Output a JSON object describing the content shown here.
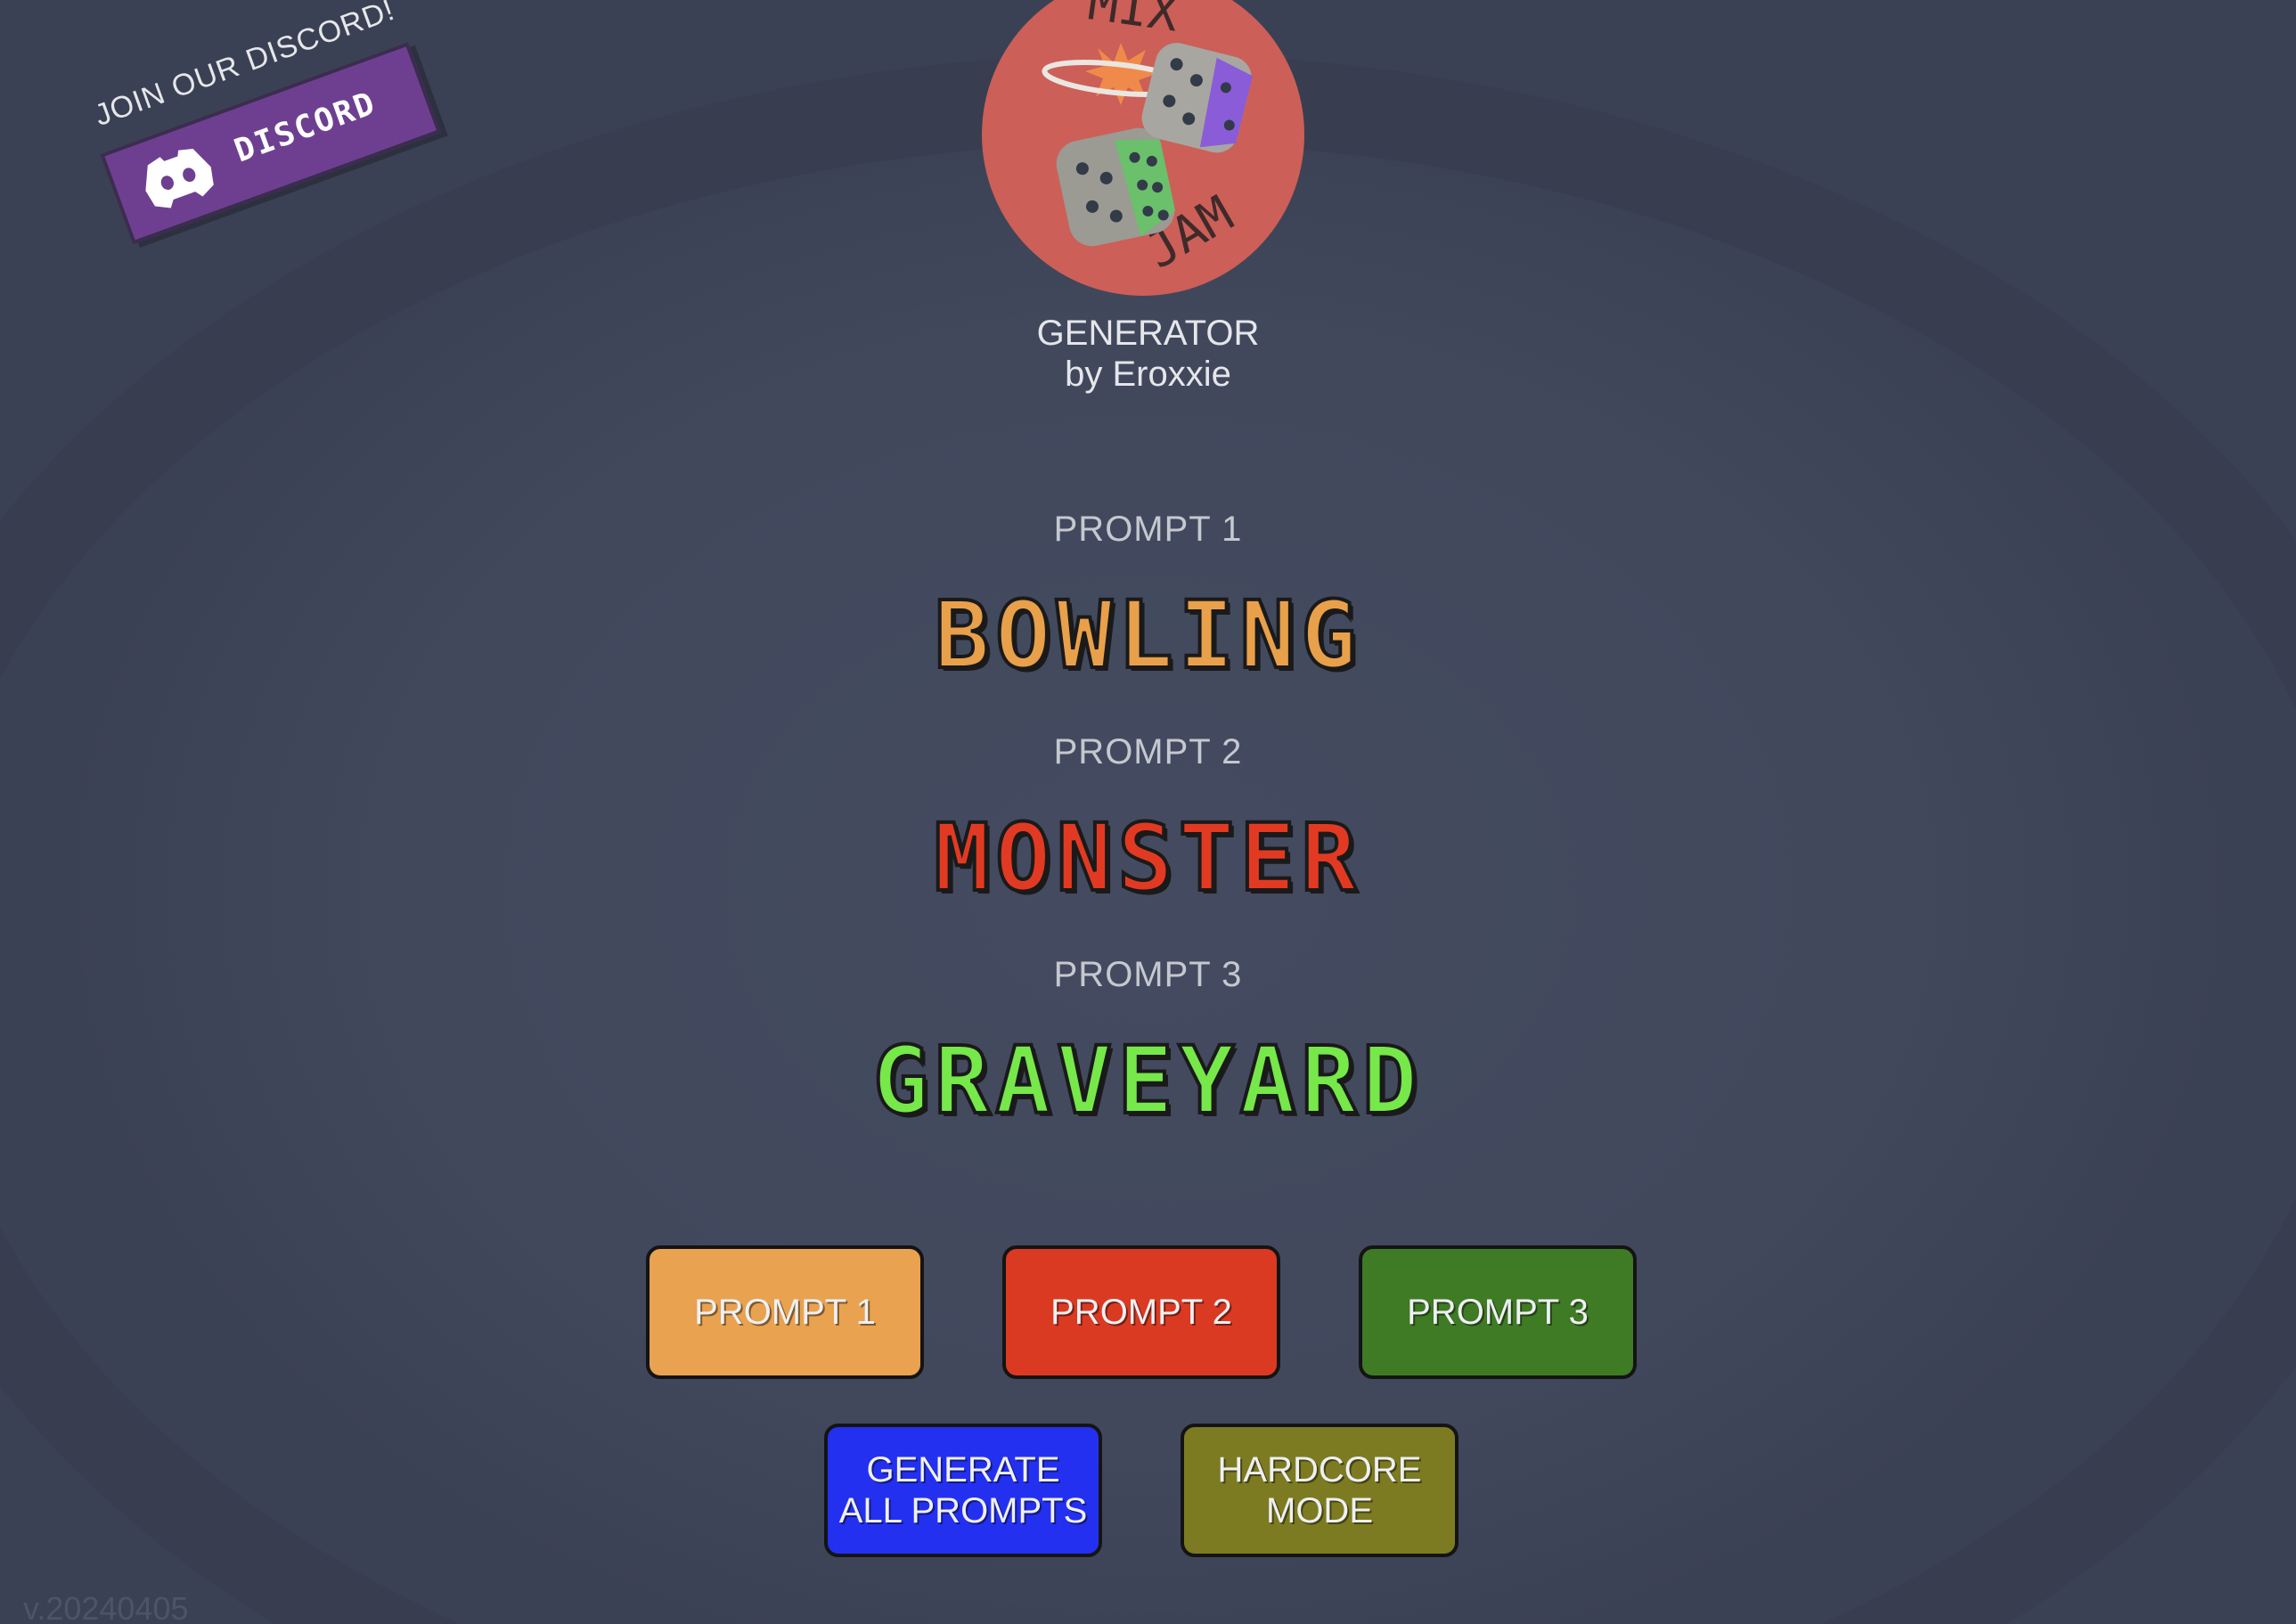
{
  "discord": {
    "join_text": "JOIN OUR DISCORD!",
    "button_label": "DISCORD"
  },
  "logo": {
    "top_text": "MIX",
    "bottom_text": "JAM"
  },
  "header": {
    "title": "GENERATOR",
    "author": "by Eroxxie"
  },
  "prompts": [
    {
      "label": "PROMPT 1",
      "word": "BOWLING",
      "color": "#e9a04a"
    },
    {
      "label": "PROMPT 2",
      "word": "MONSTER",
      "color": "#e23a22"
    },
    {
      "label": "PROMPT 3",
      "word": "GRAVEYARD",
      "color": "#76e84a"
    }
  ],
  "buttons": {
    "prompt1": {
      "label": "PROMPT 1",
      "color": "#e8a250"
    },
    "prompt2": {
      "label": "PROMPT 2",
      "color": "#db3a22"
    },
    "prompt3": {
      "label": "PROMPT 3",
      "color": "#3f7a25"
    },
    "generate_all": {
      "label": "GENERATE\nALL PROMPTS",
      "color": "#2430f0"
    },
    "hardcore": {
      "label": "HARDCORE\nMODE",
      "color": "#7d7b22"
    }
  },
  "version": "v.20240405"
}
